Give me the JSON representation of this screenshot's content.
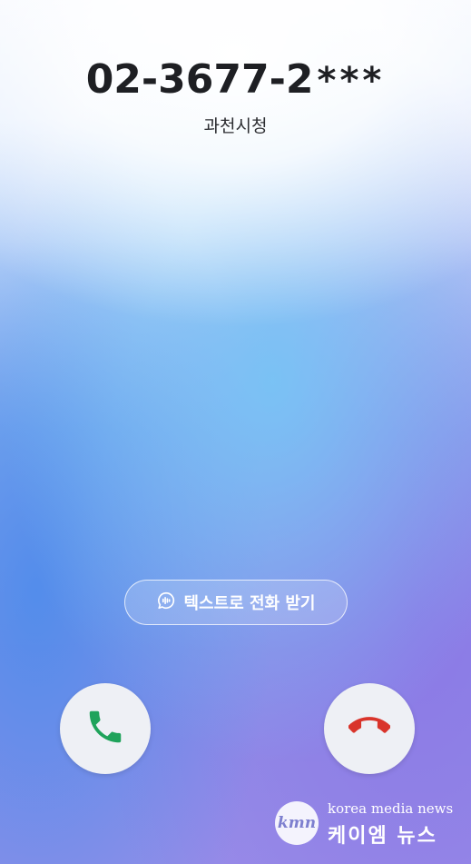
{
  "call": {
    "number": "02-3677-2",
    "number_masked": "***",
    "caller_name": "과천시청"
  },
  "actions": {
    "text_answer_label": "텍스트로 전화 받기",
    "text_answer_icon": "chat-bubble-waveform-icon",
    "accept_icon": "phone-accept-icon",
    "decline_icon": "phone-decline-icon"
  },
  "colors": {
    "accept": "#1fa35b",
    "decline": "#d9342b"
  },
  "watermark": {
    "logo": "kmn",
    "english": "korea media news",
    "korean": "케이엠 뉴스"
  }
}
